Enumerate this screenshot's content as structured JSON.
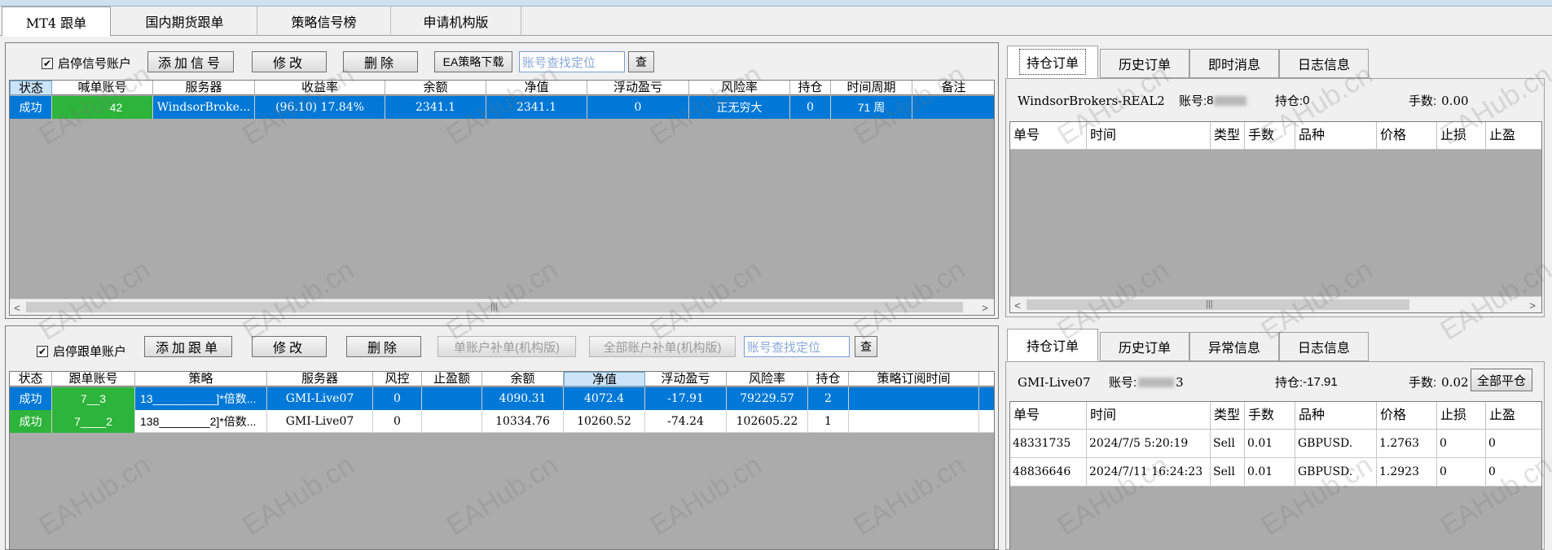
{
  "main_tabs": [
    "MT4 跟单",
    "国内期货跟单",
    "策略信号榜",
    "申请机构版"
  ],
  "signal_panel": {
    "checkbox_label": "启停信号账户",
    "checked": true,
    "add_label": "添加信号",
    "edit_label": "修改",
    "delete_label": "删除",
    "download_label": "EA策略下载",
    "search_placeholder": "账号查找定位",
    "search_button": "查",
    "columns": [
      "状态",
      "喊单账号",
      "服务器",
      "收益率",
      "余额",
      "净值",
      "浮动盈亏",
      "风险率",
      "持仓",
      "时间周期",
      "备注"
    ],
    "rows": [
      {
        "status": "成功",
        "account": "42",
        "server": "WindsorBroke...",
        "return": "(96.10) 17.84%",
        "balance": "2341.1",
        "equity": "2341.1",
        "floating": "0",
        "risk": "正无穷大",
        "positions": "0",
        "period": "71 周",
        "note": ""
      }
    ]
  },
  "signal_orders": {
    "tabs": [
      "持仓订单",
      "历史订单",
      "即时消息",
      "日志信息"
    ],
    "server": "WindsorBrokers-REAL2",
    "account_label": "账号:",
    "account_value": "8",
    "position_label": "持仓:",
    "position_value": "0",
    "lots_label": "手数:",
    "lots_value": "0.00",
    "columns": [
      "单号",
      "时间",
      "类型",
      "手数",
      "品种",
      "价格",
      "止损",
      "止盈"
    ]
  },
  "follow_panel": {
    "checkbox_label": "启停跟单账户",
    "checked": true,
    "add_label": "添加跟单",
    "edit_label": "修改",
    "delete_label": "删除",
    "single_fill_label": "单账户补单(机构版)",
    "all_fill_label": "全部账户补单(机构版)",
    "search_placeholder": "账号查找定位",
    "search_button": "查",
    "columns": [
      "状态",
      "跟单账号",
      "策略",
      "服务器",
      "风控",
      "止盈额",
      "余额",
      "净值",
      "浮动盈亏",
      "风险率",
      "持仓",
      "策略订阅时间"
    ],
    "rows": [
      {
        "status": "成功",
        "account": "7__3",
        "strategy": "13__________]*倍数...",
        "server": "GMI-Live07",
        "risk_ctrl": "0",
        "tp": "",
        "balance": "4090.31",
        "equity": "4072.4",
        "floating": "-17.91",
        "risk": "79229.57",
        "positions": "2",
        "sub_time": ""
      },
      {
        "status": "成功",
        "account": "7____2",
        "strategy": "138________2]*倍数...",
        "server": "GMI-Live07",
        "risk_ctrl": "0",
        "tp": "",
        "balance": "10334.76",
        "equity": "10260.52",
        "floating": "-74.24",
        "risk": "102605.22",
        "positions": "1",
        "sub_time": ""
      }
    ]
  },
  "follow_orders": {
    "tabs": [
      "持仓订单",
      "历史订单",
      "异常信息",
      "日志信息"
    ],
    "server": "GMI-Live07",
    "account_label": "账号:",
    "account_value": "3",
    "position_label": "持仓:",
    "position_value": "-17.91",
    "lots_label": "手数:",
    "lots_value": "0.02",
    "close_all_label": "全部平仓",
    "columns": [
      "单号",
      "时间",
      "类型",
      "手数",
      "品种",
      "价格",
      "止损",
      "止盈"
    ],
    "rows": [
      {
        "ticket": "48331735",
        "time": "2024/7/5 5:20:19",
        "type": "Sell",
        "lots": "0.01",
        "symbol": "GBPUSD.",
        "price": "1.2763",
        "sl": "0",
        "tp": "0"
      },
      {
        "ticket": "48836646",
        "time": "2024/7/11 16:24:23",
        "type": "Sell",
        "lots": "0.01",
        "symbol": "GBPUSD.",
        "price": "1.2923",
        "sl": "0",
        "tp": "0"
      }
    ]
  },
  "watermark": "EAHub.cn"
}
